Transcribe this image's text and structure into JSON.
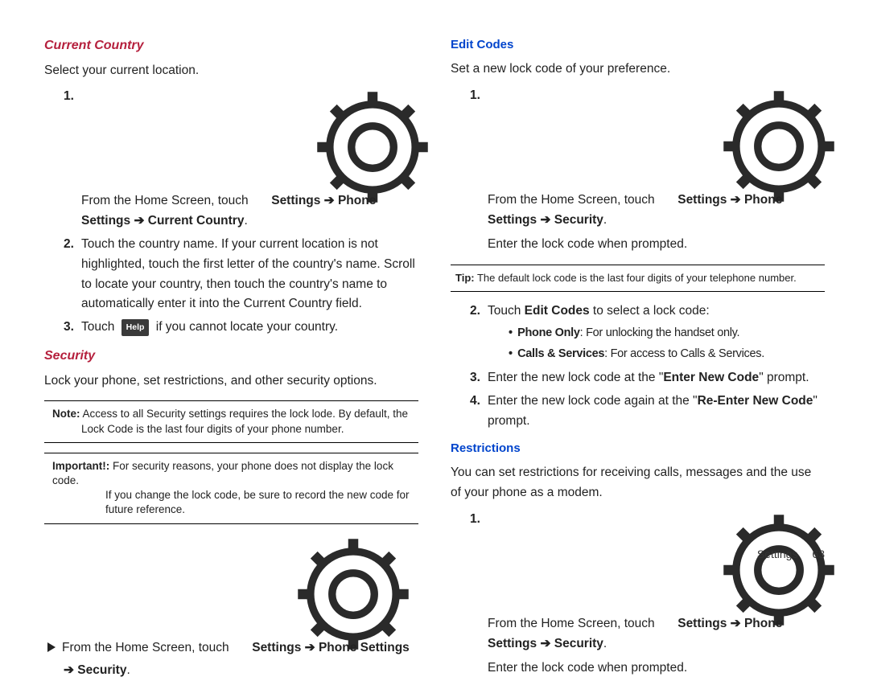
{
  "left": {
    "h_current_country": "Current Country",
    "cc_intro": "Select your current location.",
    "cc_step1_a": "From the Home Screen, touch ",
    "cc_step1_b": " Settings ➔ Phone",
    "cc_step1_c": "Settings ➔ Current Country",
    "cc_step2": "Touch the country name. If your current location is not highlighted, touch the first letter of the country's name. Scroll to locate your country, then touch the country's name to automatically enter it into the Current Country field.",
    "cc_step3_a": "Touch ",
    "cc_help": "Help",
    "cc_step3_b": " if you cannot locate your country.",
    "h_security": "Security",
    "sec_intro": "Lock your phone, set restrictions, and other security options.",
    "note_label": "Note:",
    "note_body": " Access to all Security settings requires the lock lode. By default, the",
    "note_cont": "Lock Code is the last four digits of your phone number.",
    "important_label": "Important!:",
    "important_body": " For security reasons, your phone does not display the lock code.",
    "important_cont1": "If you change the lock code, be sure to record the new code for",
    "important_cont2": "future reference.",
    "from_home_a": "From the Home Screen, touch ",
    "from_home_b": " Settings ➔ Phone Settings",
    "from_home_c": "➔ Security"
  },
  "right": {
    "h_edit_codes": "Edit Codes",
    "ec_intro": "Set a new lock code of your preference.",
    "ec_step1_a": "From the Home Screen, touch ",
    "ec_step1_b": " Settings ➔ Phone",
    "ec_step1_c": "Settings ➔ Security",
    "ec_enter_lock": "Enter the lock code when prompted.",
    "tip_label": "Tip:",
    "tip_body": " The default lock code is the last four digits of your telephone number.",
    "ec_step2_a": "Touch ",
    "ec_step2_b": "Edit Codes",
    "ec_step2_c": " to select a lock code:",
    "opt1_label": "Phone Only",
    "opt1_body": ": For unlocking the handset only.",
    "opt2_label": "Calls & Services",
    "opt2_body": ": For access to Calls & Services.",
    "ec_step3_a": "Enter the new lock code at the \"",
    "ec_step3_b": "Enter New Code",
    "ec_step3_c": "\" prompt.",
    "ec_step4_a": "Enter the new lock code again at the \"",
    "ec_step4_b": "Re-Enter New Code",
    "ec_step4_c": "\" prompt.",
    "h_restrictions": "Restrictions",
    "res_intro": "You can set restrictions for receiving calls, messages and the use of your phone as a modem.",
    "res_step1_a": "From the Home Screen, touch ",
    "res_step1_b": " Settings ➔ Phone",
    "res_step1_c": "Settings ➔ Security",
    "res_enter_lock": "Enter the lock code when prompted."
  },
  "footer": {
    "section": "Settings",
    "page": "63"
  }
}
